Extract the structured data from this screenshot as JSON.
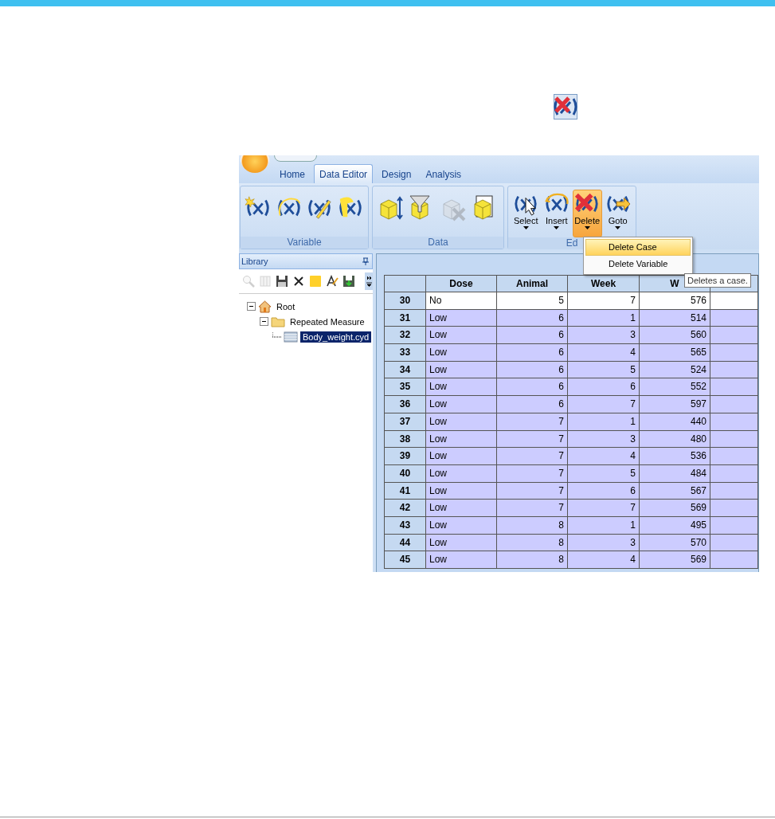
{
  "ribbon": {
    "tabs": [
      {
        "label": "Home",
        "selected": false
      },
      {
        "label": "Data Editor",
        "selected": true
      },
      {
        "label": "Design",
        "selected": false
      },
      {
        "label": "Analysis",
        "selected": false
      }
    ],
    "groups": [
      {
        "label": "Variable",
        "buttons": [
          {
            "kind": "icon",
            "disabled": false
          },
          {
            "kind": "icon",
            "disabled": false
          },
          {
            "kind": "icon",
            "disabled": false
          },
          {
            "kind": "icon",
            "disabled": false
          }
        ]
      },
      {
        "label": "Data",
        "buttons": [
          {
            "kind": "icon",
            "disabled": false
          },
          {
            "kind": "icon",
            "disabled": false
          },
          {
            "kind": "icon",
            "disabled": true
          },
          {
            "kind": "icon",
            "disabled": false
          }
        ]
      },
      {
        "label": "Ed",
        "buttons": [
          {
            "kind": "labeled",
            "label": "Select",
            "selected": false,
            "disabled": false
          },
          {
            "kind": "labeled",
            "label": "Insert",
            "selected": false,
            "disabled": false
          },
          {
            "kind": "labeled",
            "label": "Delete",
            "selected": true,
            "disabled": false
          },
          {
            "kind": "labeled",
            "label": "Goto",
            "selected": false,
            "disabled": false
          }
        ]
      }
    ]
  },
  "menu": {
    "items": [
      {
        "label": "Delete Case",
        "selected": true
      },
      {
        "label": "Delete Variable",
        "selected": false
      }
    ]
  },
  "tooltip": "Deletes a case.",
  "library": {
    "title": "Library",
    "tools": [
      {
        "disabled": true
      },
      {
        "disabled": true
      },
      {
        "disabled": false
      },
      {
        "disabled": false
      },
      {
        "disabled": false
      },
      {
        "disabled": false
      },
      {
        "disabled": false
      }
    ],
    "tree": [
      {
        "label": "Root",
        "expanded": true,
        "selected": false,
        "children": [
          {
            "label": "Repeated Measure",
            "expanded": true,
            "selected": false,
            "children": [
              {
                "label": "Body_weight.cyd",
                "selected": true
              }
            ]
          }
        ]
      }
    ]
  },
  "grid": {
    "columns": [
      "Dose",
      "Animal",
      "Week",
      "W"
    ],
    "rows": [
      {
        "number": "30",
        "cells": [
          "No",
          "5",
          "7",
          "576"
        ],
        "selected": false
      },
      {
        "number": "31",
        "cells": [
          "Low",
          "6",
          "1",
          "514"
        ],
        "selected": true
      },
      {
        "number": "32",
        "cells": [
          "Low",
          "6",
          "3",
          "560"
        ],
        "selected": true
      },
      {
        "number": "33",
        "cells": [
          "Low",
          "6",
          "4",
          "565"
        ],
        "selected": true
      },
      {
        "number": "34",
        "cells": [
          "Low",
          "6",
          "5",
          "524"
        ],
        "selected": true
      },
      {
        "number": "35",
        "cells": [
          "Low",
          "6",
          "6",
          "552"
        ],
        "selected": true
      },
      {
        "number": "36",
        "cells": [
          "Low",
          "6",
          "7",
          "597"
        ],
        "selected": true
      },
      {
        "number": "37",
        "cells": [
          "Low",
          "7",
          "1",
          "440"
        ],
        "selected": true
      },
      {
        "number": "38",
        "cells": [
          "Low",
          "7",
          "3",
          "480"
        ],
        "selected": true
      },
      {
        "number": "39",
        "cells": [
          "Low",
          "7",
          "4",
          "536"
        ],
        "selected": true
      },
      {
        "number": "40",
        "cells": [
          "Low",
          "7",
          "5",
          "484"
        ],
        "selected": true
      },
      {
        "number": "41",
        "cells": [
          "Low",
          "7",
          "6",
          "567"
        ],
        "selected": true
      },
      {
        "number": "42",
        "cells": [
          "Low",
          "7",
          "7",
          "569"
        ],
        "selected": true
      },
      {
        "number": "43",
        "cells": [
          "Low",
          "8",
          "1",
          "495"
        ],
        "selected": true
      },
      {
        "number": "44",
        "cells": [
          "Low",
          "8",
          "3",
          "570"
        ],
        "selected": true
      },
      {
        "number": "45",
        "cells": [
          "Low",
          "8",
          "4",
          "569"
        ],
        "selected": true
      }
    ]
  }
}
